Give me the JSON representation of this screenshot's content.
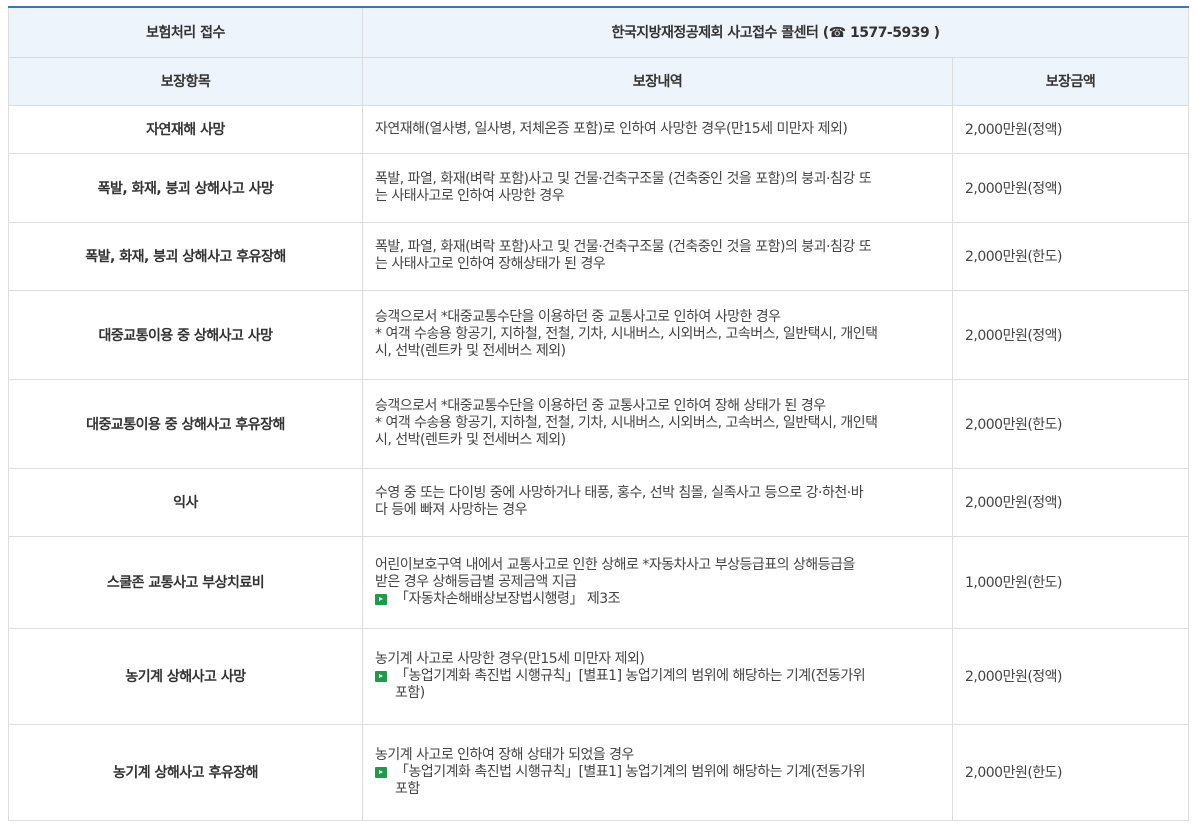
{
  "header": {
    "insurance_label": "보험처리 접수",
    "callcenter_prefix": "한국지방재정공제회 사고접수 콜센터 (",
    "phone_icon": "☎",
    "phone_number": " 1577-5939 )"
  },
  "columns": [
    "보장항목",
    "보장내역",
    "보장금액"
  ],
  "rows": [
    {
      "name": "자연재해 사망",
      "desc": [
        "자연재해(열사병, 일사병, 저체온증 포함)로 인하여 사망한 경우(만15세 미만자 제외)"
      ],
      "ref": [],
      "amount": "2,000만원(정액)"
    },
    {
      "name": "폭발, 화재, 붕괴 상해사고 사망",
      "desc": [
        "폭발, 파열, 화재(벼락 포함)사고 및 건물·건축구조물 (건축중인 것을 포함)의 붕괴·침강 또",
        "는 사태사고로 인하여 사망한 경우"
      ],
      "ref": [],
      "amount": "2,000만원(정액)"
    },
    {
      "name": "폭발, 화재, 붕괴 상해사고 후유장해",
      "desc": [
        "폭발, 파열, 화재(벼락 포함)사고 및 건물·건축구조물 (건축중인 것을 포함)의 붕괴·침강 또",
        "는 사태사고로 인하여 장해상태가 된 경우"
      ],
      "ref": [],
      "amount": "2,000만원(한도)"
    },
    {
      "name": "대중교통이용 중 상해사고 사망",
      "desc": [
        "승객으로서 *대중교통수단을 이용하던 중 교통사고로 인하여 사망한 경우",
        "* 여객 수송용 항공기, 지하철, 전철, 기차, 시내버스, 시외버스, 고속버스, 일반택시, 개인택",
        "시, 선박(렌트카 및 전세버스 제외)"
      ],
      "ref": [],
      "amount": "2,000만원(정액)"
    },
    {
      "name": "대중교통이용 중 상해사고 후유장해",
      "desc": [
        "승객으로서 *대중교통수단을 이용하던 중 교통사고로 인하여 장해 상태가 된 경우",
        "* 여객 수송용 항공기, 지하철, 전철, 기차, 시내버스, 시외버스, 고속버스, 일반택시, 개인택",
        "시, 선박(렌트카 및 전세버스 제외)"
      ],
      "ref": [],
      "amount": "2,000만원(한도)"
    },
    {
      "name": "익사",
      "desc": [
        "수영 중 또는 다이빙 중에 사망하거나 태풍, 홍수, 선박 침몰, 실족사고 등으로 강·하천·바",
        "다 등에 빠져 사망하는 경우"
      ],
      "ref": [],
      "amount": "2,000만원(정액)"
    },
    {
      "name": "스쿨존 교통사고 부상치료비",
      "desc": [
        "어린이보호구역 내에서 교통사고로 인한 상해로 *자동차사고 부상등급표의 상해등급을",
        "받은 경우 상해등급별 공제금액 지급"
      ],
      "ref": [
        "「자동차손해배상보장법시행령」 제3조"
      ],
      "amount": "1,000만원(한도)"
    },
    {
      "name": "농기계 상해사고 사망",
      "desc": [
        "농기계 사고로 사망한 경우(만15세 미만자 제외)"
      ],
      "ref": [
        "「농업기계화 촉진법 시행규칙」[별표1] 농업기계의 범위에 해당하는 기계(전동가위",
        "포함)"
      ],
      "amount": "2,000만원(정액)"
    },
    {
      "name": "농기계 상해사고 후유장해",
      "desc": [
        "농기계 사고로 인하여 장해 상태가 되었을 경우"
      ],
      "ref": [
        "「농업기계화 촉진법 시행규칙」[별표1] 농업기계의 범위에 해당하는 기계(전동가위",
        "포함"
      ],
      "amount": "2,000만원(한도)"
    }
  ]
}
